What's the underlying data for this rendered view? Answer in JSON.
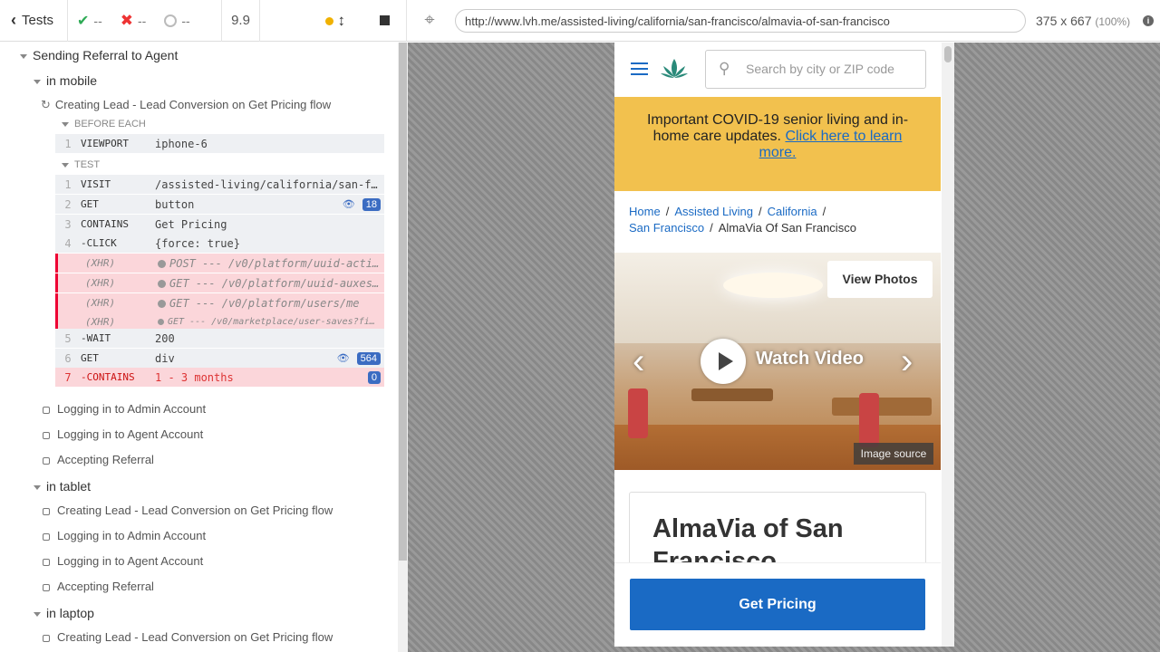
{
  "topbar": {
    "tests_label": "Tests",
    "passed": "--",
    "failed": "--",
    "pending": "--",
    "duration": "9.9",
    "url": "http://www.lvh.me/assisted-living/california/san-francisco/almavia-of-san-francisco",
    "viewport_size": "375 x 667",
    "viewport_pct": "(100%)"
  },
  "reporter": {
    "root_suite": "Sending Referral to Agent",
    "suite_mobile": "in mobile",
    "running_test": "Creating Lead - Lead Conversion on Get Pricing flow",
    "before_each": "BEFORE EACH",
    "test_label": "TEST",
    "before_cmd": {
      "num": "1",
      "name": "VIEWPORT",
      "msg": "iphone-6"
    },
    "commands": [
      {
        "num": "1",
        "name": "VISIT",
        "msg": "/assisted-living/california/san-f…"
      },
      {
        "num": "2",
        "name": "GET",
        "msg": "button",
        "badge": "18"
      },
      {
        "num": "3",
        "name": "CONTAINS",
        "msg": "Get Pricing"
      },
      {
        "num": "4",
        "name": "-CLICK",
        "msg": "{force: true}"
      },
      {
        "num": "",
        "name": "(XHR)",
        "msg": "POST --- /v0/platform/uuid-acti…"
      },
      {
        "num": "",
        "name": "(XHR)",
        "msg": "GET --- /v0/platform/uuid-auxes…"
      },
      {
        "num": "",
        "name": "(XHR)",
        "msg": "GET --- /v0/platform/users/me"
      },
      {
        "num": "",
        "name": "(XHR)",
        "msg": "GET --- /v0/marketplace/user-saves?fi…"
      },
      {
        "num": "5",
        "name": "-WAIT",
        "msg": "200"
      },
      {
        "num": "6",
        "name": "GET",
        "msg": "div",
        "badge": "564"
      },
      {
        "num": "7",
        "name": "-CONTAINS",
        "msg": "1 - 3 months",
        "badge": "0"
      }
    ],
    "mobile_tests": [
      "Logging in to Admin Account",
      "Logging in to Agent Account",
      "Accepting Referral"
    ],
    "suite_tablet": "in tablet",
    "tablet_tests": [
      "Creating Lead - Lead Conversion on Get Pricing flow",
      "Logging in to Admin Account",
      "Logging in to Agent Account",
      "Accepting Referral"
    ],
    "suite_laptop": "in laptop",
    "laptop_tests": [
      "Creating Lead - Lead Conversion on Get Pricing flow"
    ]
  },
  "site": {
    "search_placeholder": "Search by city or ZIP code",
    "covid_text": "Important COVID-19 senior living and in-home care updates.",
    "covid_link": "Click here to learn more.",
    "breadcrumbs": [
      "Home",
      "Assisted Living",
      "California",
      "San Francisco",
      "AlmaVia Of San Francisco"
    ],
    "view_photos": "View Photos",
    "watch_video": "Watch Video",
    "image_source": "Image source",
    "community_name": "AlmaVia of San Francisco",
    "get_pricing": "Get Pricing"
  },
  "colors": {
    "brand_blue": "#1a6ac4",
    "covid_bg": "#f2c14e",
    "fail_red": "#d33"
  }
}
